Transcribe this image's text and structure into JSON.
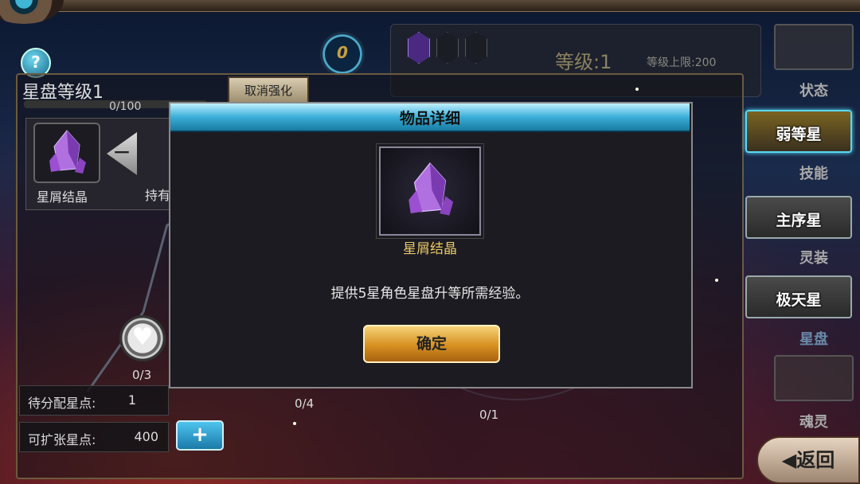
{
  "header": {
    "help_icon": "?",
    "coin_value": "0",
    "level_label": "等级:1",
    "level_cap": "等级上限:200"
  },
  "panel": {
    "title": "星盘等级1",
    "progress_text": "0/100",
    "progress_fraction": 0,
    "cancel_button": "取消强化",
    "item_name": "星屑结晶",
    "minus_label": "−",
    "hold_label": "持有",
    "heart_node_count": "0/3",
    "node2_count": "0/4",
    "node3_count": "0/1",
    "pending_points_label": "待分配星点:",
    "pending_points_value": "1",
    "expand_points_label": "可扩张星点:",
    "expand_points_value": "400",
    "plus_label": "+"
  },
  "sidebar": {
    "tabs": [
      {
        "label": "状态"
      },
      {
        "label": "技能"
      },
      {
        "label": "灵装"
      },
      {
        "label": "星盘"
      },
      {
        "label": "魂灵"
      }
    ],
    "star_buttons": [
      {
        "label": "弱等星",
        "active": true
      },
      {
        "label": "主序星",
        "active": false
      },
      {
        "label": "极天星",
        "active": false
      }
    ],
    "back_label": "返回"
  },
  "dialog": {
    "title": "物品详细",
    "item_name": "星屑结晶",
    "description": "提供5星角色星盘升等所需经验。",
    "confirm_label": "确定"
  }
}
